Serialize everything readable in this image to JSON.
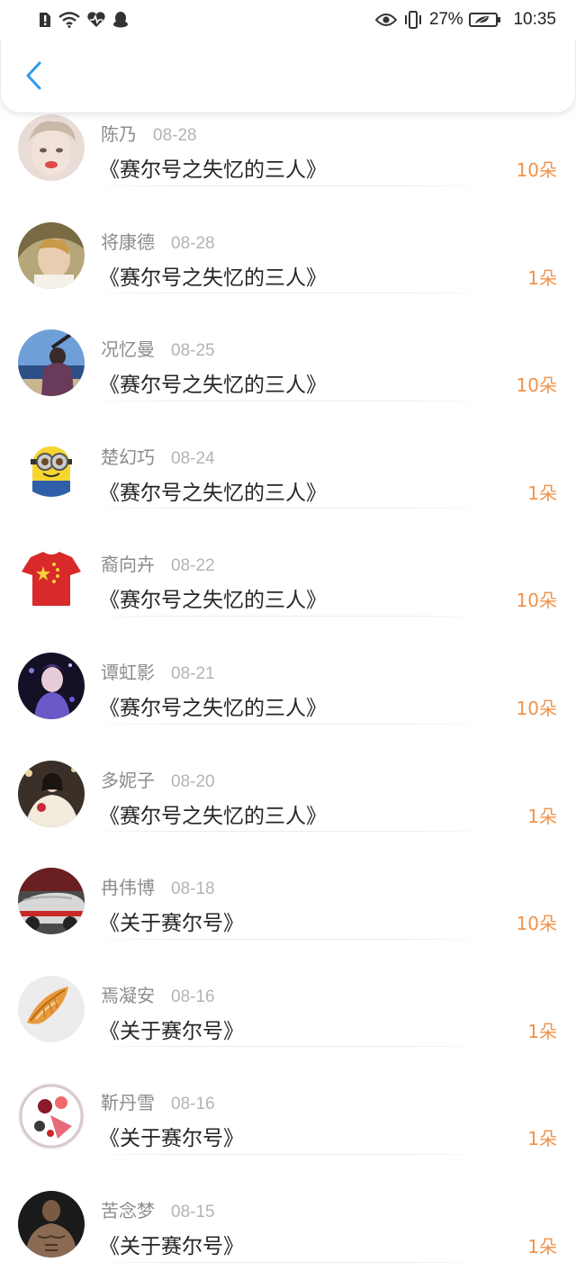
{
  "status_bar": {
    "battery_percent": "27%",
    "time": "10:35",
    "icons": [
      "alert-sim-icon",
      "wifi-icon",
      "heart-rate-icon",
      "qq-icon",
      "eye-icon",
      "vibrate-icon",
      "battery-icon"
    ]
  },
  "nav": {
    "back_icon": "chevron-left-icon",
    "accent": "#2d9cea"
  },
  "colors": {
    "amount": "#f0924a",
    "name": "#8c8c8c",
    "date": "#b4b4b4",
    "title": "#262626"
  },
  "items": [
    {
      "name": "陈乃",
      "date": "08-28",
      "title": "《赛尔号之失忆的三人》",
      "amount": "10朵",
      "avatar": "face"
    },
    {
      "name": "将康德",
      "date": "08-28",
      "title": "《赛尔号之失忆的三人》",
      "amount": "1朵",
      "avatar": "child"
    },
    {
      "name": "况忆曼",
      "date": "08-25",
      "title": "《赛尔号之失忆的三人》",
      "amount": "10朵",
      "avatar": "beach"
    },
    {
      "name": "楚幻巧",
      "date": "08-24",
      "title": "《赛尔号之失忆的三人》",
      "amount": "1朵",
      "avatar": "minion"
    },
    {
      "name": "裔向卉",
      "date": "08-22",
      "title": "《赛尔号之失忆的三人》",
      "amount": "10朵",
      "avatar": "flag-shirt"
    },
    {
      "name": "谭虹影",
      "date": "08-21",
      "title": "《赛尔号之失忆的三人》",
      "amount": "10朵",
      "avatar": "purple"
    },
    {
      "name": "多妮子",
      "date": "08-20",
      "title": "《赛尔号之失忆的三人》",
      "amount": "1朵",
      "avatar": "bride"
    },
    {
      "name": "冉伟博",
      "date": "08-18",
      "title": "《关于赛尔号》",
      "amount": "10朵",
      "avatar": "car"
    },
    {
      "name": "焉凝安",
      "date": "08-16",
      "title": "《关于赛尔号》",
      "amount": "1朵",
      "avatar": "shell"
    },
    {
      "name": "靳丹雪",
      "date": "08-16",
      "title": "《关于赛尔号》",
      "amount": "1朵",
      "avatar": "plate"
    },
    {
      "name": "苦念梦",
      "date": "08-15",
      "title": "《关于赛尔号》",
      "amount": "1朵",
      "avatar": "muscle"
    }
  ]
}
